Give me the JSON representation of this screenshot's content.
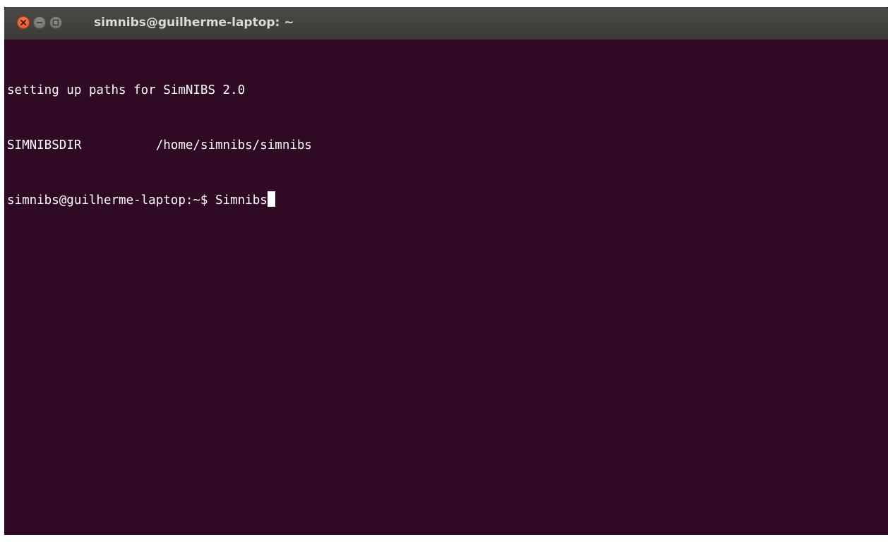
{
  "window": {
    "title": "simnibs@guilherme-laptop: ~",
    "controls": {
      "close_icon": "close-icon",
      "minimize_icon": "minimize-icon",
      "maximize_icon": "maximize-icon"
    },
    "colors": {
      "terminal_background": "#300a24",
      "terminal_text": "#ffffff",
      "close_button": "#e95420"
    }
  },
  "terminal": {
    "lines": [
      "setting up paths for SimNIBS 2.0",
      "SIMNIBSDIR          /home/simnibs/simnibs"
    ],
    "prompt": "simnibs@guilherme-laptop:~$ ",
    "input": "Simnibs"
  }
}
